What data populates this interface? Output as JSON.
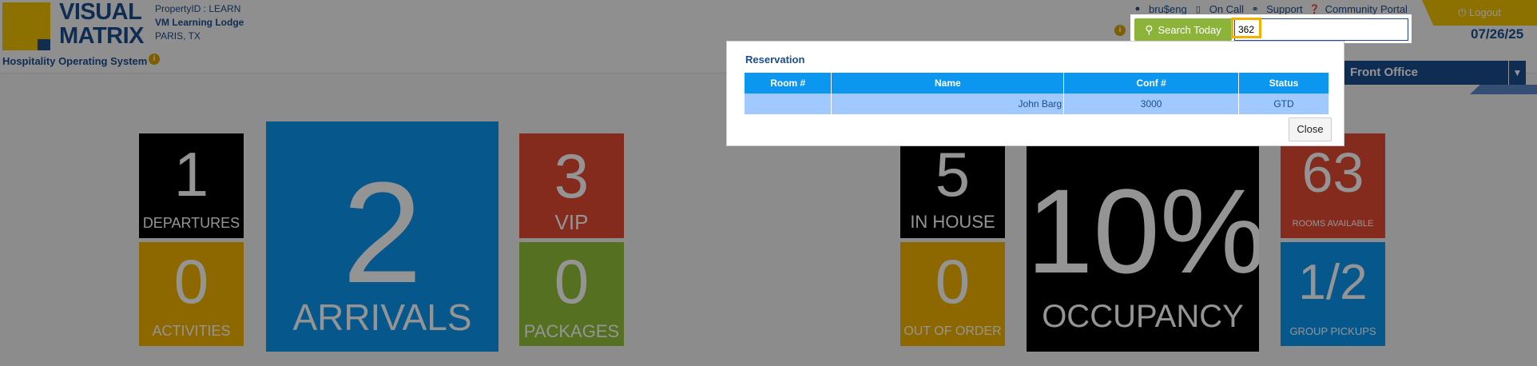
{
  "brand": {
    "logo_line1": "VISUAL",
    "logo_line2": "MATRIX",
    "tagline": "Hospitality Operating System",
    "property_id": "PropertyID : LEARN",
    "property_name": "VM Learning Lodge",
    "property_location": "PARIS, TX"
  },
  "toplinks": {
    "user": "bru$eng",
    "on_call": "On Call",
    "support": "Support",
    "community": "Community Portal",
    "logout": "Logout"
  },
  "date": "07/26/25",
  "search": {
    "button_label": "Search Today",
    "value": "362"
  },
  "nav": {
    "module": "Front Office"
  },
  "tiles": [
    {
      "id": "departures",
      "value": "1",
      "label": "DEPARTURES",
      "color": "#000000"
    },
    {
      "id": "activities",
      "value": "0",
      "label": "ACTIVITIES",
      "color": "#f3b400"
    },
    {
      "id": "arrivals",
      "value": "2",
      "label": "ARRIVALS",
      "color": "#0b97f0"
    },
    {
      "id": "vip",
      "value": "3",
      "label": "VIP",
      "color": "#e34b35"
    },
    {
      "id": "packages",
      "value": "0",
      "label": "PACKAGES",
      "color": "#95c13a"
    },
    {
      "id": "in_house",
      "value": "5",
      "label": "IN HOUSE",
      "color": "#000000"
    },
    {
      "id": "out_of_order",
      "value": "0",
      "label": "OUT OF ORDER",
      "color": "#f3b400"
    },
    {
      "id": "occupancy",
      "value": "10%",
      "label": "OCCUPANCY",
      "color": "#000000"
    },
    {
      "id": "rooms_available",
      "value": "63",
      "label": "ROOMS AVAILABLE",
      "color": "#e34b35"
    },
    {
      "id": "group_pickups",
      "value": "1/2",
      "label": "GROUP PICKUPS",
      "color": "#0b97f0"
    }
  ],
  "popup": {
    "title": "Reservation",
    "columns": [
      "Room #",
      "Name",
      "Conf #",
      "Status"
    ],
    "rows": [
      {
        "room": "",
        "name": "John Barg",
        "conf": "3000",
        "status": "GTD"
      }
    ],
    "close_label": "Close"
  }
}
